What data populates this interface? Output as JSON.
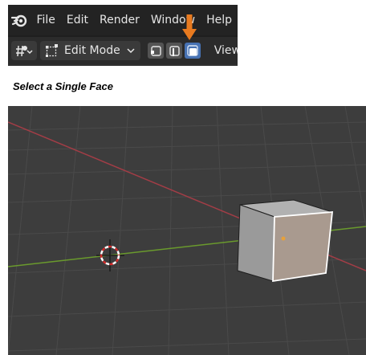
{
  "menu": {
    "items": [
      "File",
      "Edit",
      "Render",
      "Window",
      "Help"
    ]
  },
  "toolbar": {
    "mode_label": "Edit Mode",
    "view_label": "View",
    "select_modes": [
      "vertex",
      "edge",
      "face"
    ],
    "active_select_mode": "face"
  },
  "caption": "Select a Single Face",
  "colors": {
    "active_blue": "#4772b3",
    "highlight_arrow": "#e87a1f",
    "x_axis": "#a23d46",
    "y_axis": "#6a9a2d",
    "selected_face": "#a99a8f"
  }
}
